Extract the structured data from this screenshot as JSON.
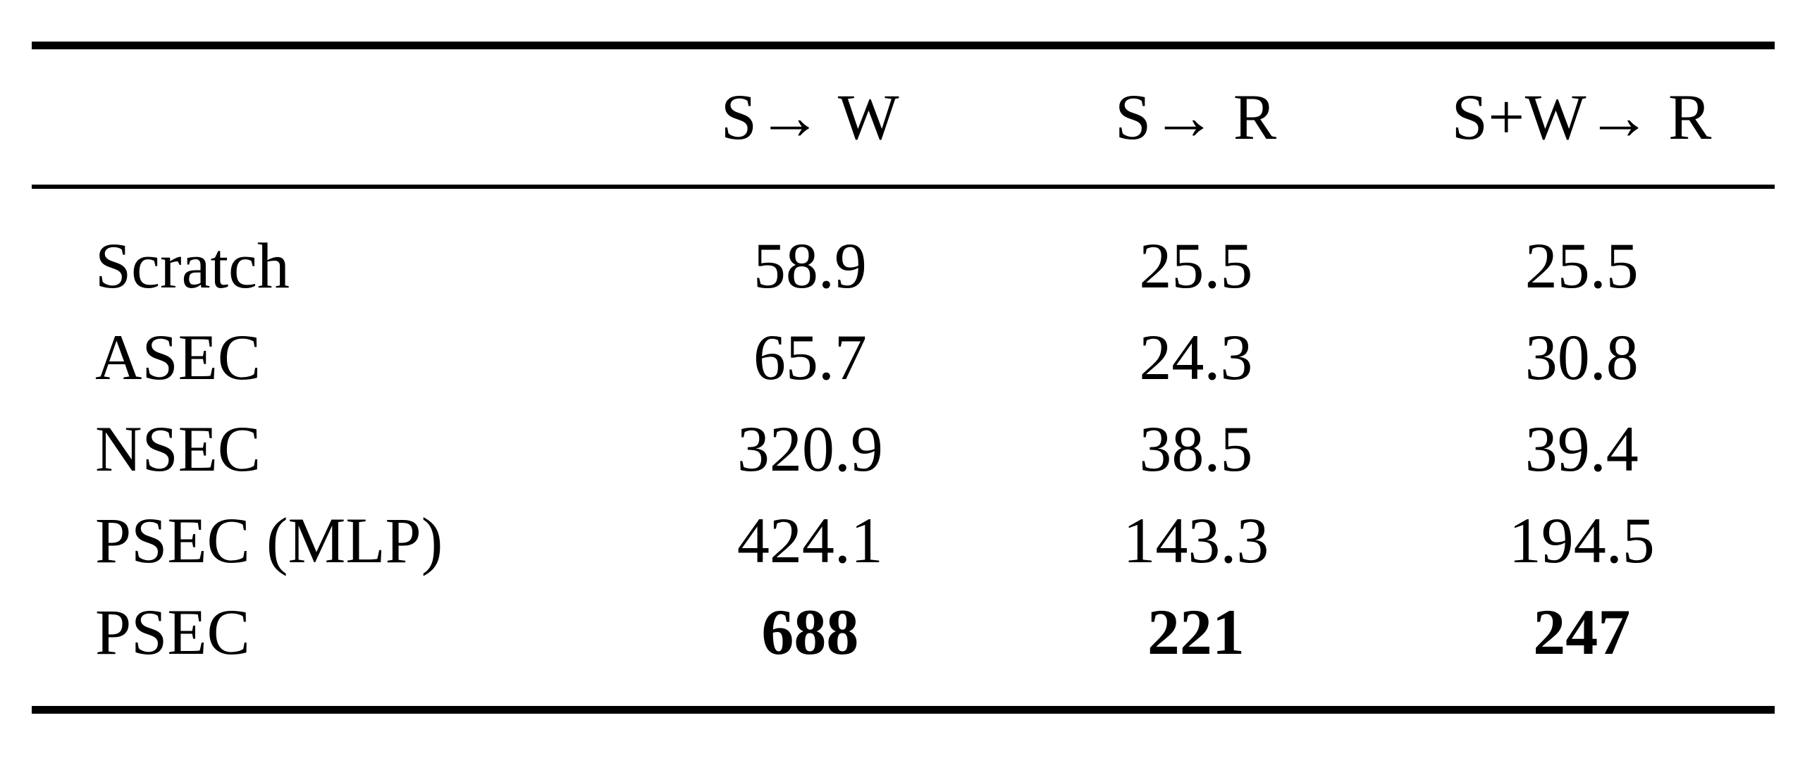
{
  "table": {
    "columns": [
      {
        "key": "label",
        "header": ""
      },
      {
        "key": "sw",
        "header": "S→ W"
      },
      {
        "key": "sr",
        "header": "S→ R"
      },
      {
        "key": "swr",
        "header": "S+W→ R"
      }
    ],
    "rows": [
      {
        "label": "Scratch",
        "sw": "58.9",
        "sr": "25.5",
        "swr": "25.5",
        "bold": false
      },
      {
        "label": "ASEC",
        "sw": "65.7",
        "sr": "24.3",
        "swr": "30.8",
        "bold": false
      },
      {
        "label": "NSEC",
        "sw": "320.9",
        "sr": "38.5",
        "swr": "39.4",
        "bold": false
      },
      {
        "label": "PSEC (MLP)",
        "sw": "424.1",
        "sr": "143.3",
        "swr": "194.5",
        "bold": false
      },
      {
        "label": "PSEC",
        "sw": "688",
        "sr": "221",
        "swr": "247",
        "bold": true
      }
    ]
  },
  "chart_data": {
    "type": "table",
    "title": "",
    "categories": [
      "Scratch",
      "ASEC",
      "NSEC",
      "PSEC (MLP)",
      "PSEC"
    ],
    "column_headers": [
      "S→ W",
      "S→ R",
      "S+W→ R"
    ],
    "series": [
      {
        "name": "S→ W",
        "values": [
          58.9,
          65.7,
          320.9,
          424.1,
          688
        ]
      },
      {
        "name": "S→ R",
        "values": [
          25.5,
          24.3,
          38.5,
          143.3,
          221
        ]
      },
      {
        "name": "S+W→ R",
        "values": [
          25.5,
          30.8,
          39.4,
          194.5,
          247
        ]
      }
    ],
    "highlighted_row": "PSEC",
    "xlabel": "",
    "ylabel": ""
  },
  "style": {
    "ink": "#000000",
    "paper": "#ffffff"
  }
}
